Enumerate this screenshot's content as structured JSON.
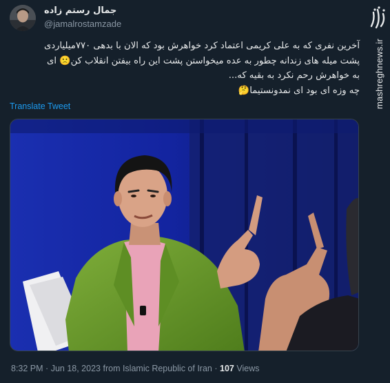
{
  "tweet": {
    "display_name": "جمال رستم زاده",
    "username": "@jamalrostamzade",
    "lines": [
      "آخرین نفری که به علی کریمی اعتماد کرد خواهرش بود که الان با بدهی ۷۷۰میلیاردی",
      "پشت میله های زندانه چطور به عده میخواستن پشت این راه بیفتن انقلاب کن🙁 ای",
      "به خواهرش رحم نکرد به بقیه که...",
      "چه وزه ای بود ای نمدونستیما🤔"
    ],
    "translate_label": "Translate Tweet",
    "time": "8:32 PM",
    "date": "Jun 18, 2023",
    "from_text": "from Islamic Republic of Iran",
    "separator": "·",
    "views_count": "107",
    "views_label": "Views"
  },
  "watermark": {
    "url": "mashreghnews.ir",
    "logo_text": "مشرق"
  },
  "colors": {
    "background": "#15202b",
    "text": "#e7e9ea",
    "secondary": "#8b98a5",
    "link": "#1d9bf0"
  }
}
